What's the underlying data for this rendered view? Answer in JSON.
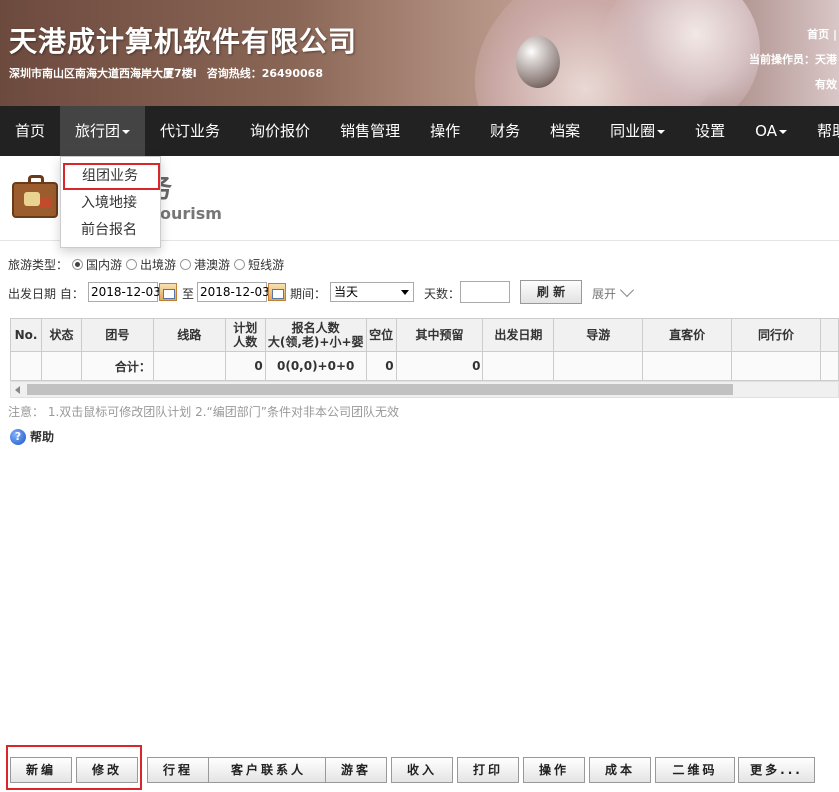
{
  "header": {
    "company_name": "天港成计算机软件有限公司",
    "address": "深圳市南山区南海大道西海岸大厦7楼I",
    "hotline": "咨询热线：26490068",
    "right_line1": "首页 |",
    "right_line2": "当前操作员：天港",
    "right_line3": "有效"
  },
  "nav": {
    "items": [
      {
        "label": "首页"
      },
      {
        "label": "旅行团"
      },
      {
        "label": "代订业务"
      },
      {
        "label": "询价报价"
      },
      {
        "label": "销售管理"
      },
      {
        "label": "操作"
      },
      {
        "label": "财务"
      },
      {
        "label": "档案"
      },
      {
        "label": "同业圈"
      },
      {
        "label": "设置"
      },
      {
        "label": "OA"
      },
      {
        "label": "帮助"
      }
    ],
    "dropdown": [
      "组团业务",
      "入境地接",
      "前台报名"
    ]
  },
  "page": {
    "title": "务",
    "subtitle": "ourism"
  },
  "filters": {
    "tour_type_label": "旅游类型：",
    "tour_types": [
      "国内游",
      "出境游",
      "港澳游",
      "短线游"
    ],
    "selected_tour_type": "国内游",
    "departure_label": "出发日期 自：",
    "date_from": "2018-12-03",
    "to_label": "至",
    "date_to": "2018-12-03",
    "period_label": "期间：",
    "period_value": "当天",
    "days_label": "天数：",
    "days_value": "",
    "refresh_label": "刷 新",
    "expand_label": "展开"
  },
  "table": {
    "headers": [
      "No.",
      "状态",
      "团号",
      "线路",
      "计划\n人数",
      "报名人数\n大(领,老)+小+婴",
      "空位",
      "其中预留",
      "出发日期",
      "导游",
      "直客价",
      "同行价"
    ],
    "total_row": {
      "label": "合计：",
      "planned": "0",
      "signup": "0(0,0)+0+0",
      "vacancy": "0",
      "reserved": "0"
    }
  },
  "note": "注意：  1.双击鼠标可修改团队计划    2.“编团部门”条件对非本公司团队无效",
  "help_label": "帮助",
  "toolbar": {
    "buttons": [
      "新编",
      "修改",
      "行程",
      "客户联系人",
      "游客",
      "收入",
      "打印",
      "操作",
      "成本",
      "二维码",
      "更多..."
    ]
  }
}
